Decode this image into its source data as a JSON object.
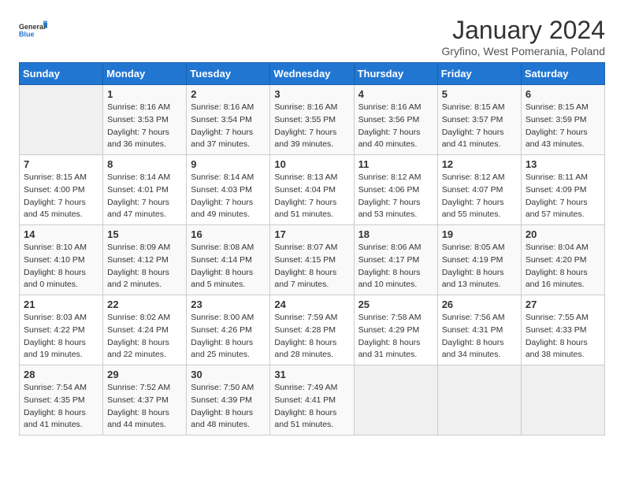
{
  "logo": {
    "line1": "General",
    "line2": "Blue"
  },
  "title": "January 2024",
  "subtitle": "Gryfino, West Pomerania, Poland",
  "days_of_week": [
    "Sunday",
    "Monday",
    "Tuesday",
    "Wednesday",
    "Thursday",
    "Friday",
    "Saturday"
  ],
  "weeks": [
    [
      {
        "day": "",
        "info": []
      },
      {
        "day": "1",
        "info": [
          "Sunrise: 8:16 AM",
          "Sunset: 3:53 PM",
          "Daylight: 7 hours",
          "and 36 minutes."
        ]
      },
      {
        "day": "2",
        "info": [
          "Sunrise: 8:16 AM",
          "Sunset: 3:54 PM",
          "Daylight: 7 hours",
          "and 37 minutes."
        ]
      },
      {
        "day": "3",
        "info": [
          "Sunrise: 8:16 AM",
          "Sunset: 3:55 PM",
          "Daylight: 7 hours",
          "and 39 minutes."
        ]
      },
      {
        "day": "4",
        "info": [
          "Sunrise: 8:16 AM",
          "Sunset: 3:56 PM",
          "Daylight: 7 hours",
          "and 40 minutes."
        ]
      },
      {
        "day": "5",
        "info": [
          "Sunrise: 8:15 AM",
          "Sunset: 3:57 PM",
          "Daylight: 7 hours",
          "and 41 minutes."
        ]
      },
      {
        "day": "6",
        "info": [
          "Sunrise: 8:15 AM",
          "Sunset: 3:59 PM",
          "Daylight: 7 hours",
          "and 43 minutes."
        ]
      }
    ],
    [
      {
        "day": "7",
        "info": [
          "Sunrise: 8:15 AM",
          "Sunset: 4:00 PM",
          "Daylight: 7 hours",
          "and 45 minutes."
        ]
      },
      {
        "day": "8",
        "info": [
          "Sunrise: 8:14 AM",
          "Sunset: 4:01 PM",
          "Daylight: 7 hours",
          "and 47 minutes."
        ]
      },
      {
        "day": "9",
        "info": [
          "Sunrise: 8:14 AM",
          "Sunset: 4:03 PM",
          "Daylight: 7 hours",
          "and 49 minutes."
        ]
      },
      {
        "day": "10",
        "info": [
          "Sunrise: 8:13 AM",
          "Sunset: 4:04 PM",
          "Daylight: 7 hours",
          "and 51 minutes."
        ]
      },
      {
        "day": "11",
        "info": [
          "Sunrise: 8:12 AM",
          "Sunset: 4:06 PM",
          "Daylight: 7 hours",
          "and 53 minutes."
        ]
      },
      {
        "day": "12",
        "info": [
          "Sunrise: 8:12 AM",
          "Sunset: 4:07 PM",
          "Daylight: 7 hours",
          "and 55 minutes."
        ]
      },
      {
        "day": "13",
        "info": [
          "Sunrise: 8:11 AM",
          "Sunset: 4:09 PM",
          "Daylight: 7 hours",
          "and 57 minutes."
        ]
      }
    ],
    [
      {
        "day": "14",
        "info": [
          "Sunrise: 8:10 AM",
          "Sunset: 4:10 PM",
          "Daylight: 8 hours",
          "and 0 minutes."
        ]
      },
      {
        "day": "15",
        "info": [
          "Sunrise: 8:09 AM",
          "Sunset: 4:12 PM",
          "Daylight: 8 hours",
          "and 2 minutes."
        ]
      },
      {
        "day": "16",
        "info": [
          "Sunrise: 8:08 AM",
          "Sunset: 4:14 PM",
          "Daylight: 8 hours",
          "and 5 minutes."
        ]
      },
      {
        "day": "17",
        "info": [
          "Sunrise: 8:07 AM",
          "Sunset: 4:15 PM",
          "Daylight: 8 hours",
          "and 7 minutes."
        ]
      },
      {
        "day": "18",
        "info": [
          "Sunrise: 8:06 AM",
          "Sunset: 4:17 PM",
          "Daylight: 8 hours",
          "and 10 minutes."
        ]
      },
      {
        "day": "19",
        "info": [
          "Sunrise: 8:05 AM",
          "Sunset: 4:19 PM",
          "Daylight: 8 hours",
          "and 13 minutes."
        ]
      },
      {
        "day": "20",
        "info": [
          "Sunrise: 8:04 AM",
          "Sunset: 4:20 PM",
          "Daylight: 8 hours",
          "and 16 minutes."
        ]
      }
    ],
    [
      {
        "day": "21",
        "info": [
          "Sunrise: 8:03 AM",
          "Sunset: 4:22 PM",
          "Daylight: 8 hours",
          "and 19 minutes."
        ]
      },
      {
        "day": "22",
        "info": [
          "Sunrise: 8:02 AM",
          "Sunset: 4:24 PM",
          "Daylight: 8 hours",
          "and 22 minutes."
        ]
      },
      {
        "day": "23",
        "info": [
          "Sunrise: 8:00 AM",
          "Sunset: 4:26 PM",
          "Daylight: 8 hours",
          "and 25 minutes."
        ]
      },
      {
        "day": "24",
        "info": [
          "Sunrise: 7:59 AM",
          "Sunset: 4:28 PM",
          "Daylight: 8 hours",
          "and 28 minutes."
        ]
      },
      {
        "day": "25",
        "info": [
          "Sunrise: 7:58 AM",
          "Sunset: 4:29 PM",
          "Daylight: 8 hours",
          "and 31 minutes."
        ]
      },
      {
        "day": "26",
        "info": [
          "Sunrise: 7:56 AM",
          "Sunset: 4:31 PM",
          "Daylight: 8 hours",
          "and 34 minutes."
        ]
      },
      {
        "day": "27",
        "info": [
          "Sunrise: 7:55 AM",
          "Sunset: 4:33 PM",
          "Daylight: 8 hours",
          "and 38 minutes."
        ]
      }
    ],
    [
      {
        "day": "28",
        "info": [
          "Sunrise: 7:54 AM",
          "Sunset: 4:35 PM",
          "Daylight: 8 hours",
          "and 41 minutes."
        ]
      },
      {
        "day": "29",
        "info": [
          "Sunrise: 7:52 AM",
          "Sunset: 4:37 PM",
          "Daylight: 8 hours",
          "and 44 minutes."
        ]
      },
      {
        "day": "30",
        "info": [
          "Sunrise: 7:50 AM",
          "Sunset: 4:39 PM",
          "Daylight: 8 hours",
          "and 48 minutes."
        ]
      },
      {
        "day": "31",
        "info": [
          "Sunrise: 7:49 AM",
          "Sunset: 4:41 PM",
          "Daylight: 8 hours",
          "and 51 minutes."
        ]
      },
      {
        "day": "",
        "info": []
      },
      {
        "day": "",
        "info": []
      },
      {
        "day": "",
        "info": []
      }
    ]
  ]
}
